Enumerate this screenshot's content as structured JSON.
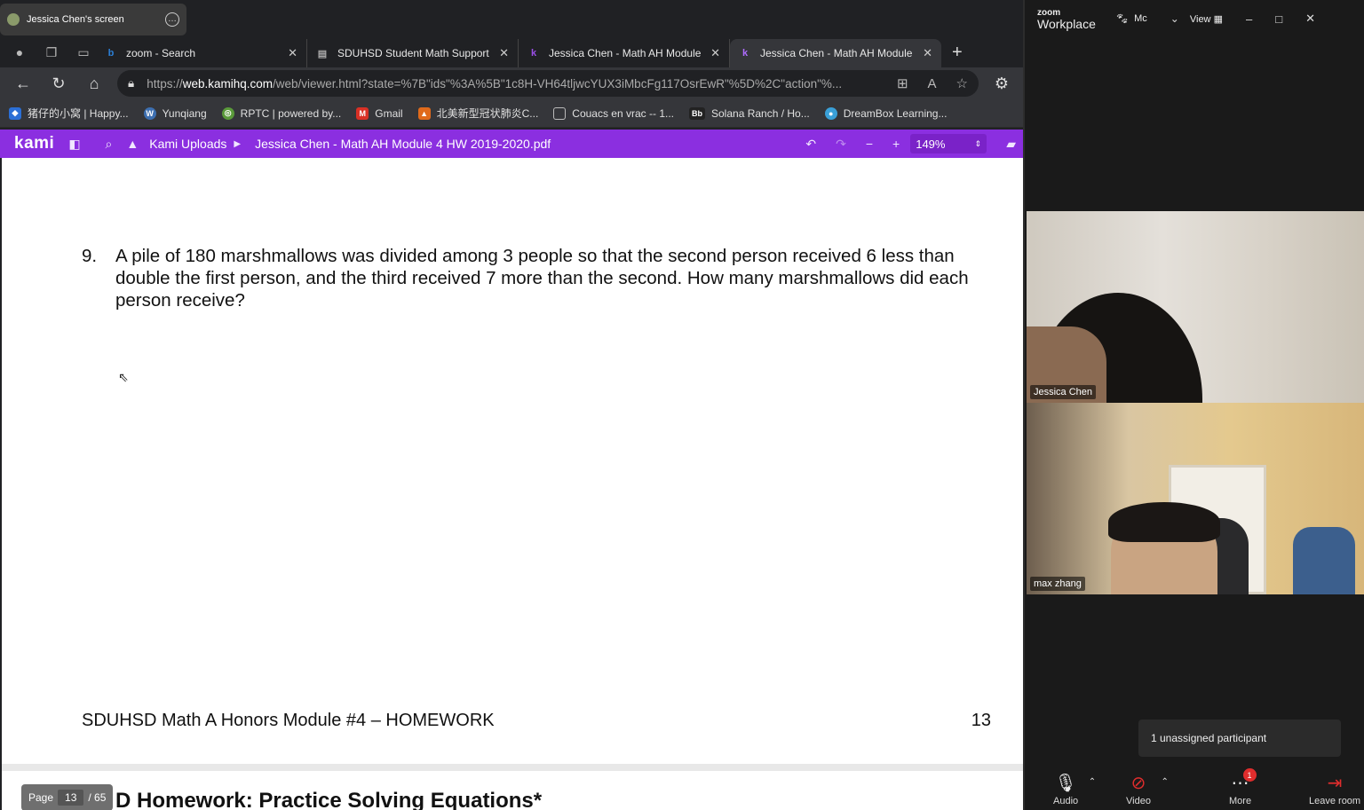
{
  "share_banner": {
    "label": "Jessica Chen's screen"
  },
  "browser": {
    "tabs": [
      {
        "label": "zoom - Search",
        "icon": "bing-icon",
        "active": false
      },
      {
        "label": "SDUHSD Student Math Support",
        "icon": "page-icon",
        "active": false
      },
      {
        "label": "Jessica Chen - Math AH Module",
        "icon": "kami-icon",
        "active": false
      },
      {
        "label": "Jessica Chen - Math AH Module",
        "icon": "kami-icon",
        "active": true
      }
    ],
    "url_prefix": "https://",
    "url_host": "web.kamihq.com",
    "url_rest": "/web/viewer.html?state=%7B\"ids\"%3A%5B\"1c8H-VH64tljwcYUX3iMbcFg117OsrEwR\"%5D%2C\"action\"%...",
    "bookmarks": [
      {
        "label": "猪仔的小窝 | Happy...",
        "color": "#2b6fd6"
      },
      {
        "label": "Yunqiang",
        "color": "#3d6fb0"
      },
      {
        "label": "RPTC | powered by...",
        "color": "#5a9a3a"
      },
      {
        "label": "Gmail",
        "color": "#d93025"
      },
      {
        "label": "北美新型冠状肺炎C...",
        "color": "#e06a1b"
      },
      {
        "label": "Couacs en vrac -- 1...",
        "color": "#777777"
      },
      {
        "label": "Solana Ranch / Ho...",
        "color": "#222222"
      },
      {
        "label": "DreamBox Learning...",
        "color": "#3aa0d8"
      }
    ]
  },
  "kami": {
    "logo": "kami",
    "crumb": "Kami Uploads",
    "file": "Jessica Chen - Math AH Module 4 HW 2019-2020.pdf",
    "zoom": "149%",
    "accent": "#8b2fe0"
  },
  "document": {
    "question_number": "9.",
    "question_text": "A pile of 180 marshmallows was divided among 3 people so that the second person received 6 less than double the first person, and the third received 7 more than the second.  How many marshmallows did each person receive?",
    "footer_left": "SDUHSD Math A Honors Module #4 – HOMEWORK",
    "footer_right": "13",
    "next_heading": "D Homework: Practice Solving Equations*",
    "pager": {
      "label": "Page",
      "current": "13",
      "total": "/ 65"
    }
  },
  "zoom": {
    "brand_top": "zoom",
    "brand_bottom": "Workplace",
    "me_label": "Mc",
    "view_label": "View",
    "participants": [
      {
        "name": "Jessica Chen"
      },
      {
        "name": "max zhang"
      }
    ],
    "unassigned": "1 unassigned participant",
    "controls": {
      "audio": "Audio",
      "video": "Video",
      "more": "More",
      "more_badge": "1",
      "leave": "Leave room"
    }
  }
}
